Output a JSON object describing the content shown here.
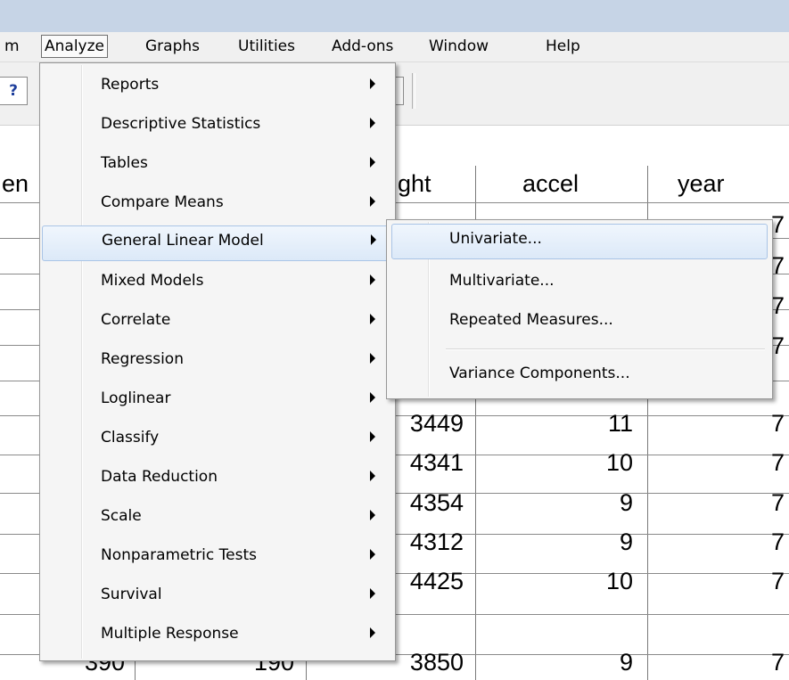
{
  "menubar": {
    "items": [
      {
        "label": "m"
      },
      {
        "label": "Analyze"
      },
      {
        "label": "Graphs"
      },
      {
        "label": "Utilities"
      },
      {
        "label": "Add-ons"
      },
      {
        "label": "Window"
      },
      {
        "label": "Help"
      }
    ]
  },
  "toolbar": {
    "help_button_glyph": "?"
  },
  "grid": {
    "columns": [
      "en",
      "ght",
      "accel",
      "year"
    ],
    "rows": [
      {
        "weight": "3449",
        "accel": "11",
        "year": "7"
      },
      {
        "weight": "4341",
        "accel": "10",
        "year": "7"
      },
      {
        "weight": "4354",
        "accel": "9",
        "year": "7"
      },
      {
        "weight": "4312",
        "accel": "9",
        "year": "7"
      },
      {
        "weight": "4425",
        "accel": "10",
        "year": "7"
      },
      {
        "partial1": "390",
        "partial2": "190",
        "weight": "3850",
        "accel": "9",
        "year": "7"
      }
    ],
    "hidden_year_cells": [
      "7",
      "7",
      "7",
      "7"
    ]
  },
  "analyze_menu": {
    "items": [
      {
        "label": "Reports"
      },
      {
        "label": "Descriptive Statistics"
      },
      {
        "label": "Tables"
      },
      {
        "label": "Compare Means"
      },
      {
        "label": "General Linear Model"
      },
      {
        "label": "Mixed Models"
      },
      {
        "label": "Correlate"
      },
      {
        "label": "Regression"
      },
      {
        "label": "Loglinear"
      },
      {
        "label": "Classify"
      },
      {
        "label": "Data Reduction"
      },
      {
        "label": "Scale"
      },
      {
        "label": "Nonparametric Tests"
      },
      {
        "label": "Survival"
      },
      {
        "label": "Multiple Response"
      }
    ],
    "highlighted": "General Linear Model"
  },
  "glm_submenu": {
    "items": [
      {
        "label": "Univariate..."
      },
      {
        "label": "Multivariate..."
      },
      {
        "label": "Repeated Measures..."
      },
      {
        "label": "Variance Components..."
      }
    ],
    "highlighted": "Univariate..."
  }
}
